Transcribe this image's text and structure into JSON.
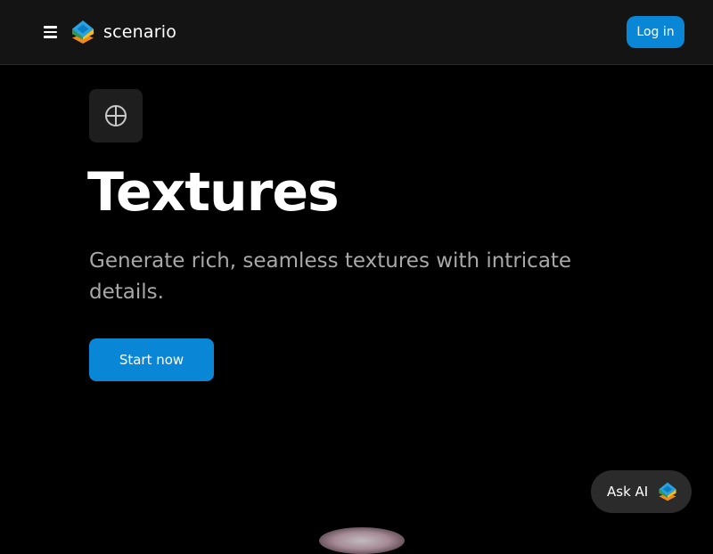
{
  "header": {
    "brand_name": "scenario",
    "login_label": "Log in"
  },
  "icons": {
    "menu": "hamburger-menu-icon",
    "brand": "scenario-logo-icon",
    "feature": "crosshair-globe-icon",
    "ask_ai": "scenario-logo-icon"
  },
  "hero": {
    "title": "Textures",
    "subtitle": "Generate rich, seamless textures with intricate details.",
    "cta_label": "Start now"
  },
  "assistant": {
    "label": "Ask AI"
  },
  "colors": {
    "background": "#000000",
    "header_background": "#141414",
    "accent": "#0a86d6",
    "subtitle_text": "#a8a8a8",
    "chip_background": "#2b2b2b"
  }
}
